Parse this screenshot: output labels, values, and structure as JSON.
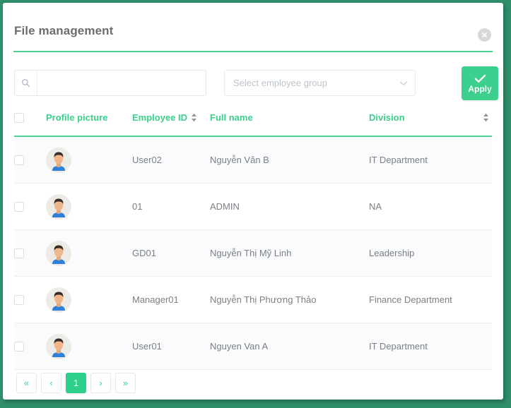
{
  "theme": {
    "accent": "#3ccf8d",
    "accent_strong": "#2ecf8a",
    "backdrop": "#2f8f6b",
    "title_color": "#6d6d6d",
    "row_alt": "#fafbfd"
  },
  "modal": {
    "title": "File management",
    "close_icon": "close-circle-icon"
  },
  "filters": {
    "search": {
      "icon": "search-icon",
      "value": "",
      "placeholder": ""
    },
    "employee_group": {
      "placeholder": "Select employee group",
      "selected": "",
      "chevron_icon": "chevron-down-icon",
      "options": []
    },
    "apply": {
      "label": "Apply",
      "icon": "check-icon"
    }
  },
  "table": {
    "select_all_checked": false,
    "columns": [
      {
        "key": "check",
        "label": "",
        "sortable": false
      },
      {
        "key": "avatar",
        "label": "Profile picture",
        "sortable": false
      },
      {
        "key": "empid",
        "label": "Employee ID",
        "sortable": true
      },
      {
        "key": "name",
        "label": "Full name",
        "sortable": false
      },
      {
        "key": "div",
        "label": "Division",
        "sortable": true
      }
    ],
    "rows": [
      {
        "checked": false,
        "avatar": "default-user-avatar",
        "employee_id": "User02",
        "full_name": "Nguyễn Văn B",
        "division": "IT Department"
      },
      {
        "checked": false,
        "avatar": "default-user-avatar",
        "employee_id": "01",
        "full_name": "ADMIN",
        "division": "NA"
      },
      {
        "checked": false,
        "avatar": "default-user-avatar",
        "employee_id": "GD01",
        "full_name": "Nguyễn Thị Mỹ Linh",
        "division": "Leadership"
      },
      {
        "checked": false,
        "avatar": "default-user-avatar",
        "employee_id": "Manager01",
        "full_name": "Nguyễn Thị Phương Thảo",
        "division": "Finance Department"
      },
      {
        "checked": false,
        "avatar": "default-user-avatar",
        "employee_id": "User01",
        "full_name": "Nguyen Van A",
        "division": "IT Department"
      }
    ]
  },
  "pagination": {
    "current_page": "1",
    "buttons": [
      {
        "key": "first",
        "label": "«",
        "active": false
      },
      {
        "key": "prev",
        "label": "‹",
        "active": false
      },
      {
        "key": "p1",
        "label": "1",
        "active": true
      },
      {
        "key": "next",
        "label": "›",
        "active": false
      },
      {
        "key": "last",
        "label": "»",
        "active": false
      }
    ]
  }
}
